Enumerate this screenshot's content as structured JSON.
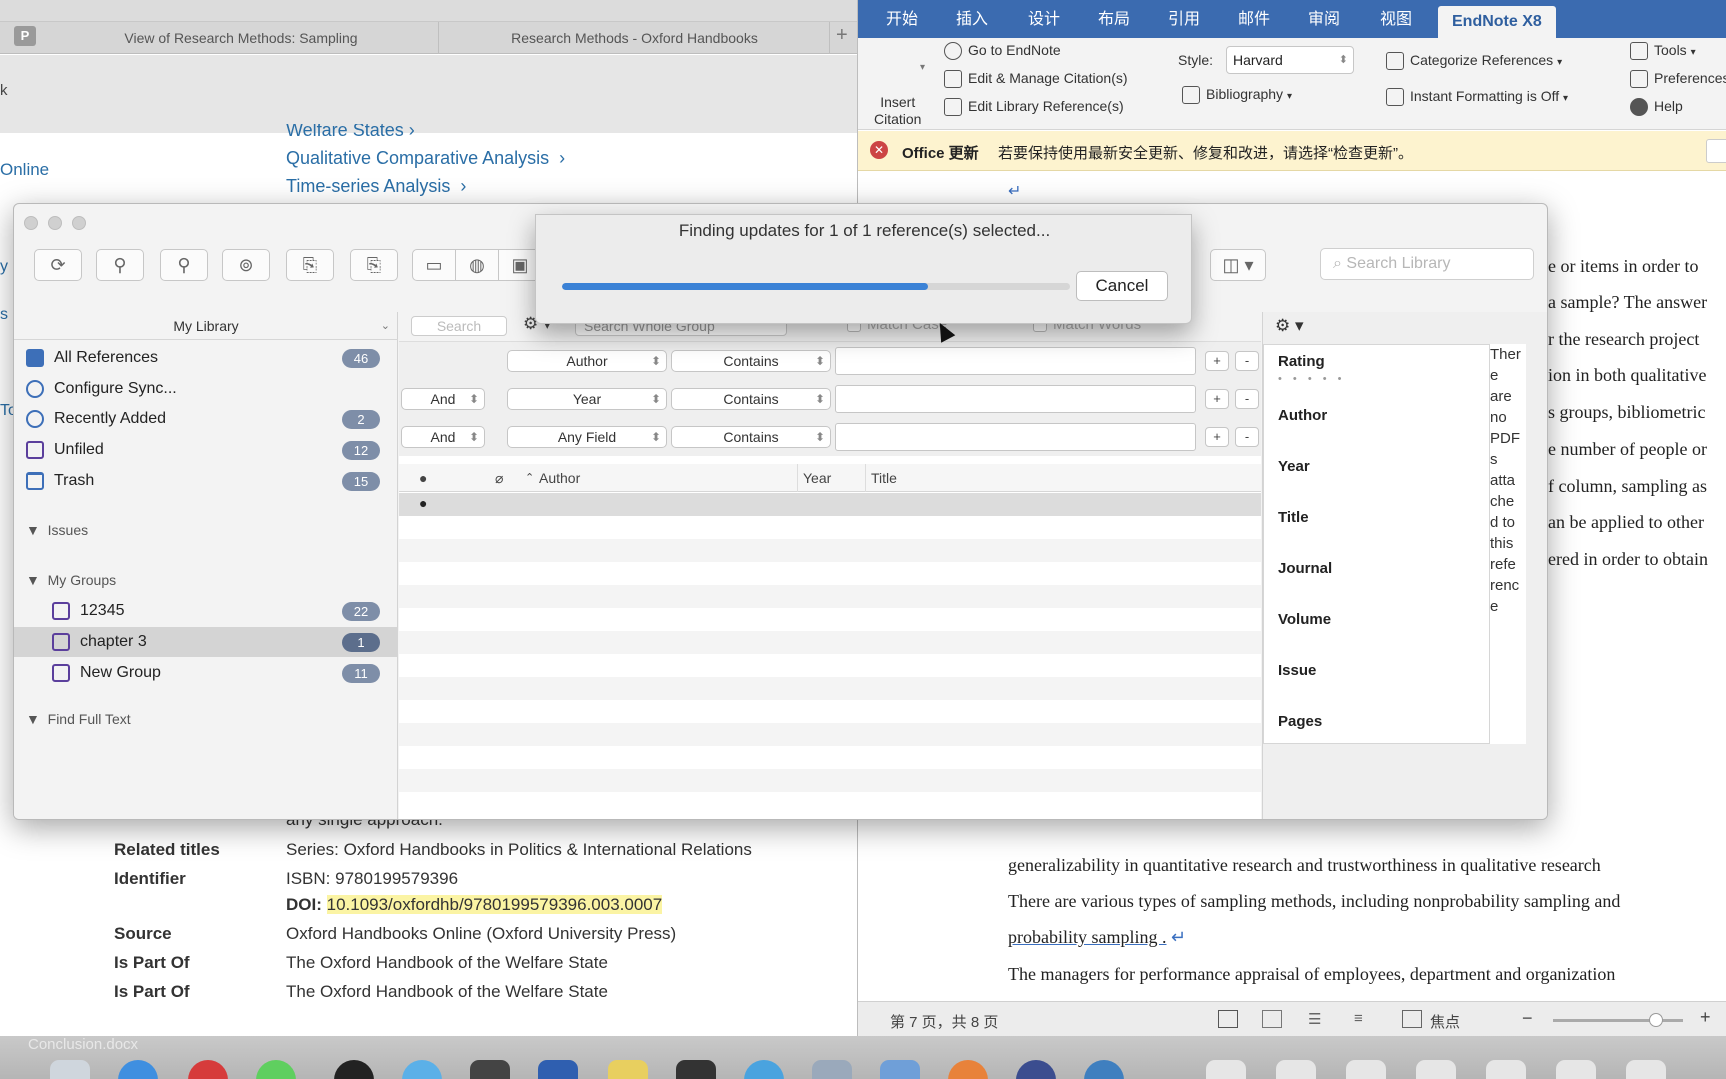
{
  "browser": {
    "tabs": [
      "View of Research Methods: Sampling",
      "Research Methods - Oxford Handbooks"
    ],
    "tab_badge": "P",
    "left_partial": [
      "k",
      "Online",
      "y",
      "s",
      "To"
    ],
    "breadcrumb_links": [
      "Welfare States",
      "Qualitative Comparative Analysis",
      "Time-series Analysis"
    ],
    "partial_text": "any single approach.",
    "metadata": [
      {
        "label": "Related titles",
        "value": "Series: Oxford Handbooks in Politics & International Relations"
      },
      {
        "label": "Identifier",
        "value": "ISBN: 9780199579396"
      },
      {
        "label": "",
        "value_prefix": "DOI: ",
        "value": "10.1093/oxfordhb/9780199579396.003.0007"
      },
      {
        "label": "Source",
        "value": "Oxford Handbooks Online (Oxford University Press)"
      },
      {
        "label": "Is Part Of",
        "value": "The Oxford Handbook of the Welfare State"
      },
      {
        "label": "Is Part Of",
        "value": "The Oxford Handbook of the Welfare State"
      }
    ]
  },
  "word": {
    "ribbon_tabs": [
      "开始",
      "插入",
      "设计",
      "布局",
      "引用",
      "邮件",
      "审阅",
      "视图"
    ],
    "active_tab": "EndNote X8",
    "insert_citation": [
      "Insert",
      "Citation"
    ],
    "buttons": {
      "go_to": "Go to EndNote",
      "edit_manage": "Edit & Manage Citation(s)",
      "edit_library": "Edit Library Reference(s)",
      "style_label": "Style:",
      "style_value": "Harvard",
      "bibliography": "Bibliography",
      "categorize": "Categorize References",
      "instant_formatting": "Instant Formatting is Off",
      "tools": "Tools",
      "preferences": "Preferences",
      "help": "Help"
    },
    "update_bar": {
      "title": "Office 更新",
      "message": "若要保持使用最新安全更新、修复和改进，请选择“检查更新”。"
    },
    "doc_right_fragments": [
      "e or items in order to",
      "a sample? The answer",
      "r the research project",
      "ion in both qualitative",
      "s groups, bibliometric",
      "e number of people or",
      "f column, sampling as",
      "an be applied to other",
      "ered in order to obtain"
    ],
    "doc_bottom": [
      "generalizability in quantitative research and trustworthiness in qualitative research",
      "There are various types of sampling methods, including nonprobability sampling and",
      "probability sampling .",
      "The managers for performance appraisal of employees, department and organization"
    ],
    "status": {
      "page": "第 7 页，共 8 页",
      "focus": "焦点"
    },
    "zoom_level": 0.79
  },
  "endnote": {
    "search_placeholder": "Search Library",
    "library_selector": "My Library",
    "sidebar": {
      "items": [
        {
          "label": "All References",
          "count": "46"
        },
        {
          "label": "Configure Sync...",
          "count": ""
        },
        {
          "label": "Recently Added",
          "count": "2"
        },
        {
          "label": "Unfiled",
          "count": "12"
        },
        {
          "label": "Trash",
          "count": "15"
        }
      ],
      "section_issues": "Issues",
      "section_groups": "My Groups",
      "groups": [
        {
          "label": "12345",
          "count": "22"
        },
        {
          "label": "chapter 3",
          "count": "1"
        },
        {
          "label": "New Group",
          "count": "11"
        }
      ],
      "section_fulltext": "Find Full Text"
    },
    "search_bar": {
      "search_button": "Search",
      "scope": "Search Whole Group",
      "match_case": "Match Case",
      "match_words": "Match Words"
    },
    "search_rows": [
      {
        "bool": "",
        "field": "Author",
        "op": "Contains"
      },
      {
        "bool": "And",
        "field": "Year",
        "op": "Contains"
      },
      {
        "bool": "And",
        "field": "Any Field",
        "op": "Contains"
      }
    ],
    "columns": {
      "author": "Author",
      "year": "Year",
      "title": "Title"
    },
    "panel_fields": [
      "Rating",
      "Author",
      "Year",
      "Title",
      "Journal",
      "Volume",
      "Issue",
      "Pages"
    ],
    "rating_dots": "• • • • •",
    "pdf_strip": [
      "Ther",
      "e",
      "are",
      "no",
      "PDF",
      "s",
      "atta",
      "che",
      "d to",
      "this",
      "refe",
      "renc",
      "e"
    ]
  },
  "dialog": {
    "title": "Finding updates for 1 of 1 reference(s) selected...",
    "cancel": "Cancel",
    "progress": 0.72
  },
  "dock": {
    "label": "Conclusion.docx"
  }
}
